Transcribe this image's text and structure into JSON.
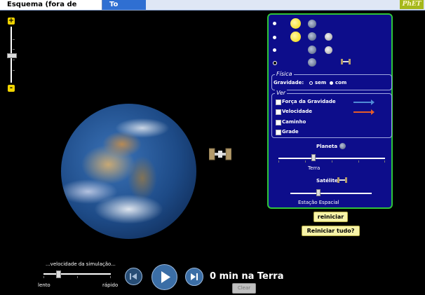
{
  "tabs": [
    {
      "label": "Esquema (fora de escala)",
      "active": true
    },
    {
      "label": "To Scale",
      "active": false
    }
  ],
  "logo": "PhET",
  "zoom": {
    "plus": "+",
    "minus": "-"
  },
  "panel": {
    "rows": [
      {
        "selected": false,
        "icons": [
          "sun-icon",
          "planet-icon"
        ]
      },
      {
        "selected": false,
        "icons": [
          "sun-icon",
          "planet-icon",
          "moon-icon"
        ]
      },
      {
        "selected": false,
        "icons": [
          "planet-icon",
          "moon-icon"
        ]
      },
      {
        "selected": true,
        "icons": [
          "planet-icon",
          "satellite-icon"
        ]
      }
    ],
    "fisica": {
      "title": "Física",
      "gravity_label": "Gravidade:",
      "option_off": "sem",
      "option_on": "com",
      "selected": "com"
    },
    "ver": {
      "title": "Ver",
      "items": [
        {
          "label": "Força da Gravidade",
          "checked": false,
          "arrow_color": "#4f8bd6"
        },
        {
          "label": "Velocidade",
          "checked": false,
          "arrow_color": "#e35c2a"
        },
        {
          "label": "Caminho",
          "checked": false
        },
        {
          "label": "Grade",
          "checked": false
        }
      ]
    },
    "planet_slider": {
      "title": "Planeta",
      "value_label": "Terra",
      "position": 0.4
    },
    "satellite_slider": {
      "title": "Satélite",
      "value_label": "Estação Espacial",
      "position": 0.35
    }
  },
  "buttons": {
    "reset": "reiniciar",
    "reset_all": "Reiniciar tudo?"
  },
  "speed": {
    "title": "...velocidade da simulação...",
    "slow": "lento",
    "fast": "rápido",
    "position": 0.2
  },
  "time": {
    "readout": "0 min na Terra"
  },
  "clear_label": "Clear"
}
